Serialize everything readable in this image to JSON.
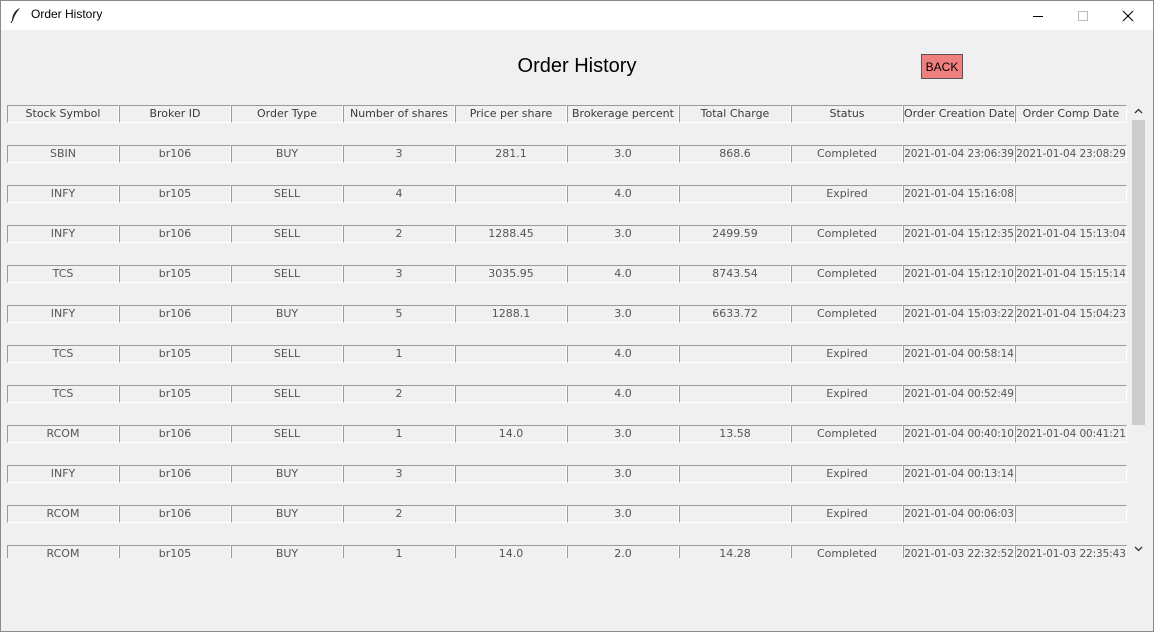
{
  "window": {
    "title": "Order History",
    "icons": {
      "app": "feather-icon",
      "minimize": "minimize-icon",
      "maximize": "maximize-icon",
      "close": "close-icon"
    }
  },
  "page": {
    "heading": "Order History",
    "back_label": "BACK",
    "back_color": "#f08080"
  },
  "table": {
    "columns": [
      "Stock Symbol",
      "Broker ID",
      "Order Type",
      "Number of shares",
      "Price per share",
      "Brokerage percent",
      "Total Charge",
      "Status",
      "Order Creation Date",
      "Order Comp Date"
    ],
    "rows": [
      [
        "SBIN",
        "br106",
        "BUY",
        "3",
        "281.1",
        "3.0",
        "868.6",
        "Completed",
        "2021-01-04 23:06:39",
        "2021-01-04 23:08:29"
      ],
      [
        "INFY",
        "br105",
        "SELL",
        "4",
        "",
        "4.0",
        "",
        "Expired",
        "2021-01-04 15:16:08",
        ""
      ],
      [
        "INFY",
        "br106",
        "SELL",
        "2",
        "1288.45",
        "3.0",
        "2499.59",
        "Completed",
        "2021-01-04 15:12:35",
        "2021-01-04 15:13:04"
      ],
      [
        "TCS",
        "br105",
        "SELL",
        "3",
        "3035.95",
        "4.0",
        "8743.54",
        "Completed",
        "2021-01-04 15:12:10",
        "2021-01-04 15:15:14"
      ],
      [
        "INFY",
        "br106",
        "BUY",
        "5",
        "1288.1",
        "3.0",
        "6633.72",
        "Completed",
        "2021-01-04 15:03:22",
        "2021-01-04 15:04:23"
      ],
      [
        "TCS",
        "br105",
        "SELL",
        "1",
        "",
        "4.0",
        "",
        "Expired",
        "2021-01-04 00:58:14",
        ""
      ],
      [
        "TCS",
        "br105",
        "SELL",
        "2",
        "",
        "4.0",
        "",
        "Expired",
        "2021-01-04 00:52:49",
        ""
      ],
      [
        "RCOM",
        "br106",
        "SELL",
        "1",
        "14.0",
        "3.0",
        "13.58",
        "Completed",
        "2021-01-04 00:40:10",
        "2021-01-04 00:41:21"
      ],
      [
        "INFY",
        "br106",
        "BUY",
        "3",
        "",
        "3.0",
        "",
        "Expired",
        "2021-01-04 00:13:14",
        ""
      ],
      [
        "RCOM",
        "br106",
        "BUY",
        "2",
        "",
        "3.0",
        "",
        "Expired",
        "2021-01-04 00:06:03",
        ""
      ],
      [
        "RCOM",
        "br105",
        "BUY",
        "1",
        "14.0",
        "2.0",
        "14.28",
        "Completed",
        "2021-01-03 22:32:52",
        "2021-01-03 22:35:43"
      ]
    ]
  },
  "scrollbar": {
    "up_icon": "chevron-up-icon",
    "down_icon": "chevron-down-icon"
  }
}
